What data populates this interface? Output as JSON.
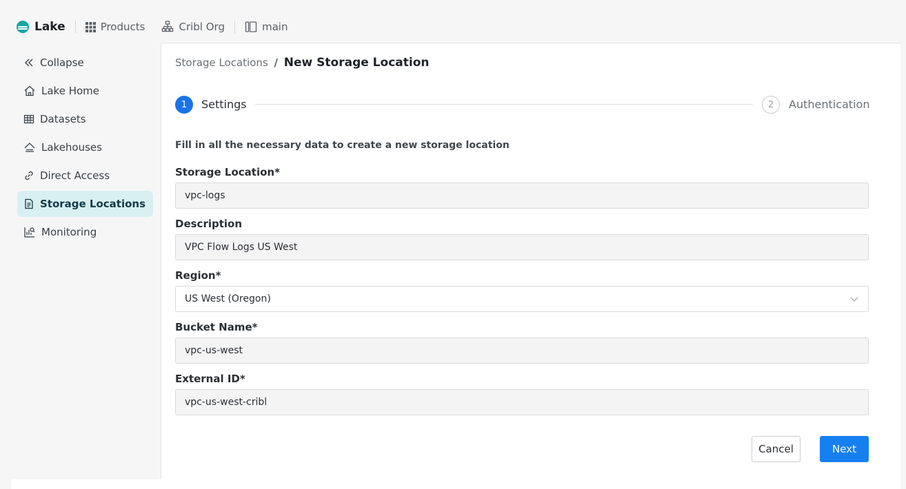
{
  "topbar": {
    "app_name": "Lake",
    "products_label": "Products",
    "org_label": "Cribl Org",
    "workspace_label": "main"
  },
  "sidebar": {
    "items": [
      {
        "label": "Collapse",
        "icon": "double-chevron-left-icon"
      },
      {
        "label": "Lake Home",
        "icon": "home-icon"
      },
      {
        "label": "Datasets",
        "icon": "table-icon"
      },
      {
        "label": "Lakehouses",
        "icon": "lakehouse-icon"
      },
      {
        "label": "Direct Access",
        "icon": "link-icon"
      },
      {
        "label": "Storage Locations",
        "icon": "document-icon",
        "active": true
      },
      {
        "label": "Monitoring",
        "icon": "monitoring-icon"
      }
    ]
  },
  "breadcrumb": {
    "parent": "Storage Locations",
    "separator": "/",
    "current": "New Storage Location"
  },
  "stepper": {
    "steps": [
      {
        "number": "1",
        "label": "Settings",
        "active": true
      },
      {
        "number": "2",
        "label": "Authentication",
        "active": false
      }
    ]
  },
  "form": {
    "instructions": "Fill in all the necessary data to create a new storage location",
    "storage_location": {
      "label": "Storage Location*",
      "value": "vpc-logs"
    },
    "description": {
      "label": "Description",
      "value": "VPC Flow Logs US West"
    },
    "region": {
      "label": "Region*",
      "value": "US West (Oregon)"
    },
    "bucket_name": {
      "label": "Bucket Name*",
      "value": "vpc-us-west"
    },
    "external_id": {
      "label": "External ID*",
      "value": "vpc-us-west-cribl"
    }
  },
  "actions": {
    "cancel_label": "Cancel",
    "next_label": "Next"
  },
  "colors": {
    "accent": "#1a73e8",
    "brand": "#15a6a2",
    "active_nav_bg": "#d8f0f2"
  }
}
